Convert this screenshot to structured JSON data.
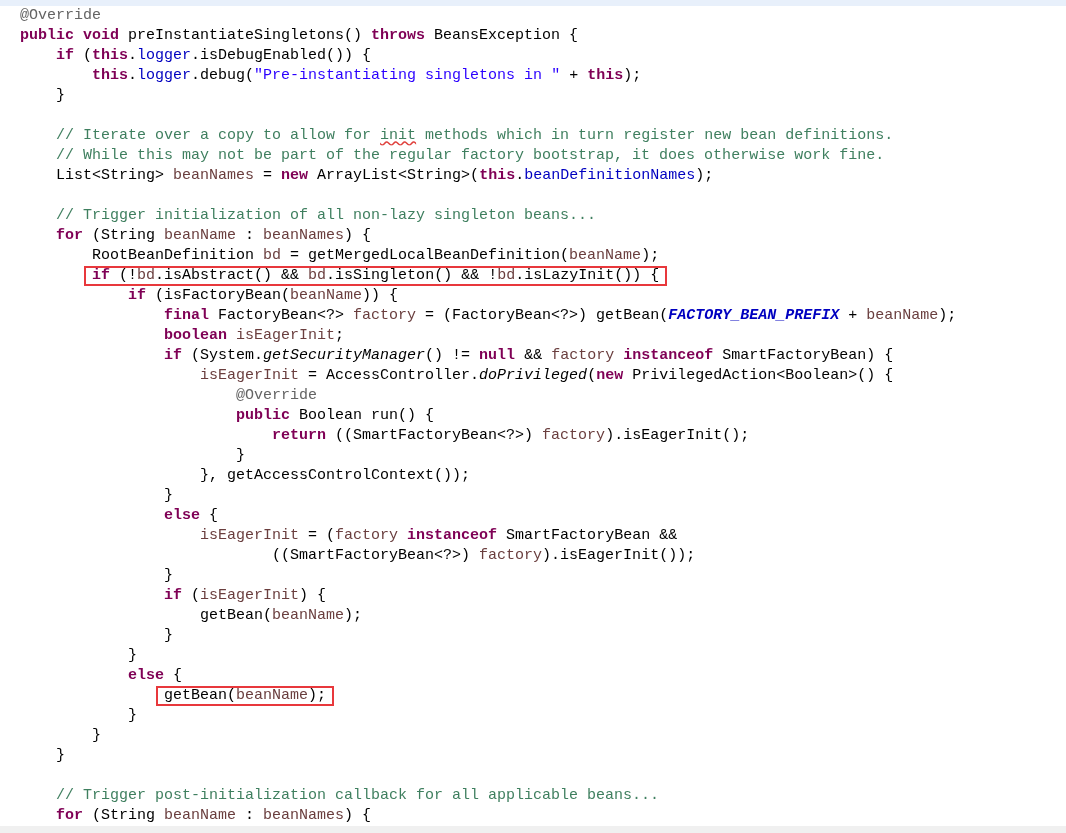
{
  "editor": {
    "lines": [
      {
        "kind": "code",
        "boxed": false,
        "tokens": [
          {
            "kind": "annotation",
            "text": "@Override"
          }
        ]
      },
      {
        "kind": "code",
        "boxed": false,
        "tokens": [
          {
            "kind": "keyword",
            "text": "public void"
          },
          {
            "kind": "plain",
            "text": " preInstantiateSingletons() "
          },
          {
            "kind": "keyword",
            "text": "throws"
          },
          {
            "kind": "plain",
            "text": " BeansException {"
          }
        ]
      },
      {
        "kind": "code",
        "boxed": false,
        "tokens": [
          {
            "kind": "keyword",
            "text": "    if"
          },
          {
            "kind": "plain",
            "text": " ("
          },
          {
            "kind": "keyword",
            "text": "this"
          },
          {
            "kind": "plain",
            "text": "."
          },
          {
            "kind": "field",
            "text": "logger"
          },
          {
            "kind": "plain",
            "text": ".isDebugEnabled()) {"
          }
        ]
      },
      {
        "kind": "code",
        "boxed": false,
        "tokens": [
          {
            "kind": "keyword",
            "text": "        this"
          },
          {
            "kind": "plain",
            "text": "."
          },
          {
            "kind": "field",
            "text": "logger"
          },
          {
            "kind": "plain",
            "text": ".debug("
          },
          {
            "kind": "string",
            "text": "\"Pre-instantiating singletons in \""
          },
          {
            "kind": "plain",
            "text": " + "
          },
          {
            "kind": "keyword",
            "text": "this"
          },
          {
            "kind": "plain",
            "text": ");"
          }
        ]
      },
      {
        "kind": "code",
        "boxed": false,
        "tokens": [
          {
            "kind": "plain",
            "text": "    }"
          }
        ]
      },
      {
        "kind": "blank"
      },
      {
        "kind": "code",
        "boxed": false,
        "tokens": [
          {
            "kind": "comment",
            "text": "    // Iterate over a copy to allow for "
          },
          {
            "kind": "typo",
            "text": "init"
          },
          {
            "kind": "comment",
            "text": " methods which in turn register new bean definitions."
          }
        ]
      },
      {
        "kind": "code",
        "boxed": false,
        "tokens": [
          {
            "kind": "comment",
            "text": "    // While this may not be part of the regular factory bootstrap, it does otherwise work fine."
          }
        ]
      },
      {
        "kind": "code",
        "boxed": false,
        "tokens": [
          {
            "kind": "plain",
            "text": "    List<String> "
          },
          {
            "kind": "local",
            "text": "beanNames"
          },
          {
            "kind": "plain",
            "text": " = "
          },
          {
            "kind": "keyword",
            "text": "new"
          },
          {
            "kind": "plain",
            "text": " ArrayList<String>("
          },
          {
            "kind": "keyword",
            "text": "this"
          },
          {
            "kind": "plain",
            "text": "."
          },
          {
            "kind": "field",
            "text": "beanDefinitionNames"
          },
          {
            "kind": "plain",
            "text": ");"
          }
        ]
      },
      {
        "kind": "blank"
      },
      {
        "kind": "code",
        "boxed": false,
        "tokens": [
          {
            "kind": "comment",
            "text": "    // Trigger initialization of all non-lazy singleton beans..."
          }
        ]
      },
      {
        "kind": "code",
        "boxed": false,
        "tokens": [
          {
            "kind": "keyword",
            "text": "    for"
          },
          {
            "kind": "plain",
            "text": " (String "
          },
          {
            "kind": "local",
            "text": "beanName"
          },
          {
            "kind": "plain",
            "text": " : "
          },
          {
            "kind": "local",
            "text": "beanNames"
          },
          {
            "kind": "plain",
            "text": ") {"
          }
        ]
      },
      {
        "kind": "code",
        "boxed": false,
        "tokens": [
          {
            "kind": "plain",
            "text": "        RootBeanDefinition "
          },
          {
            "kind": "local",
            "text": "bd"
          },
          {
            "kind": "plain",
            "text": " = getMergedLocalBeanDefinition("
          },
          {
            "kind": "local",
            "text": "beanName"
          },
          {
            "kind": "plain",
            "text": ");"
          }
        ]
      },
      {
        "kind": "code",
        "boxed": true,
        "tokens": [
          {
            "kind": "keyword",
            "text": "        if"
          },
          {
            "kind": "plain",
            "text": " (!"
          },
          {
            "kind": "local",
            "text": "bd"
          },
          {
            "kind": "plain",
            "text": ".isAbstract() && "
          },
          {
            "kind": "local",
            "text": "bd"
          },
          {
            "kind": "plain",
            "text": ".isSingleton() && !"
          },
          {
            "kind": "local",
            "text": "bd"
          },
          {
            "kind": "plain",
            "text": ".isLazyInit()) {"
          }
        ]
      },
      {
        "kind": "code",
        "boxed": false,
        "tokens": [
          {
            "kind": "keyword",
            "text": "            if"
          },
          {
            "kind": "plain",
            "text": " (isFactoryBean("
          },
          {
            "kind": "local",
            "text": "beanName"
          },
          {
            "kind": "plain",
            "text": ")) {"
          }
        ]
      },
      {
        "kind": "code",
        "boxed": false,
        "tokens": [
          {
            "kind": "keyword",
            "text": "                final"
          },
          {
            "kind": "plain",
            "text": " FactoryBean<?> "
          },
          {
            "kind": "local",
            "text": "factory"
          },
          {
            "kind": "plain",
            "text": " = (FactoryBean<?>) getBean("
          },
          {
            "kind": "constant",
            "text": "FACTORY_BEAN_PREFIX"
          },
          {
            "kind": "plain",
            "text": " + "
          },
          {
            "kind": "local",
            "text": "beanName"
          },
          {
            "kind": "plain",
            "text": ");"
          }
        ]
      },
      {
        "kind": "code",
        "boxed": false,
        "tokens": [
          {
            "kind": "keyword",
            "text": "                boolean"
          },
          {
            "kind": "local",
            "text": " isEagerInit"
          },
          {
            "kind": "plain",
            "text": ";"
          }
        ]
      },
      {
        "kind": "code",
        "boxed": false,
        "tokens": [
          {
            "kind": "keyword",
            "text": "                if"
          },
          {
            "kind": "plain",
            "text": " (System."
          },
          {
            "kind": "static",
            "text": "getSecurityManager"
          },
          {
            "kind": "plain",
            "text": "() != "
          },
          {
            "kind": "keyword",
            "text": "null"
          },
          {
            "kind": "plain",
            "text": " && "
          },
          {
            "kind": "local",
            "text": "factory "
          },
          {
            "kind": "keyword",
            "text": "instanceof"
          },
          {
            "kind": "plain",
            "text": " SmartFactoryBean) {"
          }
        ]
      },
      {
        "kind": "code",
        "boxed": false,
        "tokens": [
          {
            "kind": "local",
            "text": "                    isEagerInit"
          },
          {
            "kind": "plain",
            "text": " = AccessController."
          },
          {
            "kind": "static",
            "text": "doPrivileged"
          },
          {
            "kind": "plain",
            "text": "("
          },
          {
            "kind": "keyword",
            "text": "new"
          },
          {
            "kind": "plain",
            "text": " PrivilegedAction<Boolean>() {"
          }
        ]
      },
      {
        "kind": "code",
        "boxed": false,
        "tokens": [
          {
            "kind": "annotation",
            "text": "                        @Override"
          }
        ]
      },
      {
        "kind": "code",
        "boxed": false,
        "tokens": [
          {
            "kind": "keyword",
            "text": "                        public"
          },
          {
            "kind": "plain",
            "text": " Boolean run() {"
          }
        ]
      },
      {
        "kind": "code",
        "boxed": false,
        "tokens": [
          {
            "kind": "keyword",
            "text": "                            return"
          },
          {
            "kind": "plain",
            "text": " ((SmartFactoryBean<?>) "
          },
          {
            "kind": "local",
            "text": "factory"
          },
          {
            "kind": "plain",
            "text": ").isEagerInit();"
          }
        ]
      },
      {
        "kind": "code",
        "boxed": false,
        "tokens": [
          {
            "kind": "plain",
            "text": "                        }"
          }
        ]
      },
      {
        "kind": "code",
        "boxed": false,
        "tokens": [
          {
            "kind": "plain",
            "text": "                    }, getAccessControlContext());"
          }
        ]
      },
      {
        "kind": "code",
        "boxed": false,
        "tokens": [
          {
            "kind": "plain",
            "text": "                }"
          }
        ]
      },
      {
        "kind": "code",
        "boxed": false,
        "tokens": [
          {
            "kind": "keyword",
            "text": "                else"
          },
          {
            "kind": "plain",
            "text": " {"
          }
        ]
      },
      {
        "kind": "code",
        "boxed": false,
        "tokens": [
          {
            "kind": "local",
            "text": "                    isEagerInit"
          },
          {
            "kind": "plain",
            "text": " = ("
          },
          {
            "kind": "local",
            "text": "factory "
          },
          {
            "kind": "keyword",
            "text": "instanceof"
          },
          {
            "kind": "plain",
            "text": " SmartFactoryBean &&"
          }
        ]
      },
      {
        "kind": "code",
        "boxed": false,
        "tokens": [
          {
            "kind": "plain",
            "text": "                            ((SmartFactoryBean<?>) "
          },
          {
            "kind": "local",
            "text": "factory"
          },
          {
            "kind": "plain",
            "text": ").isEagerInit());"
          }
        ]
      },
      {
        "kind": "code",
        "boxed": false,
        "tokens": [
          {
            "kind": "plain",
            "text": "                }"
          }
        ]
      },
      {
        "kind": "code",
        "boxed": false,
        "tokens": [
          {
            "kind": "keyword",
            "text": "                if"
          },
          {
            "kind": "plain",
            "text": " ("
          },
          {
            "kind": "local",
            "text": "isEagerInit"
          },
          {
            "kind": "plain",
            "text": ") {"
          }
        ]
      },
      {
        "kind": "code",
        "boxed": false,
        "tokens": [
          {
            "kind": "plain",
            "text": "                    getBean("
          },
          {
            "kind": "local",
            "text": "beanName"
          },
          {
            "kind": "plain",
            "text": ");"
          }
        ]
      },
      {
        "kind": "code",
        "boxed": false,
        "tokens": [
          {
            "kind": "plain",
            "text": "                }"
          }
        ]
      },
      {
        "kind": "code",
        "boxed": false,
        "tokens": [
          {
            "kind": "plain",
            "text": "            }"
          }
        ]
      },
      {
        "kind": "code",
        "boxed": false,
        "tokens": [
          {
            "kind": "keyword",
            "text": "            else"
          },
          {
            "kind": "plain",
            "text": " {"
          }
        ]
      },
      {
        "kind": "code",
        "boxed": true,
        "tokens": [
          {
            "kind": "plain",
            "text": "                getBean("
          },
          {
            "kind": "local",
            "text": "beanName"
          },
          {
            "kind": "plain",
            "text": ");"
          }
        ]
      },
      {
        "kind": "code",
        "boxed": false,
        "tokens": [
          {
            "kind": "plain",
            "text": "            }"
          }
        ]
      },
      {
        "kind": "code",
        "boxed": false,
        "tokens": [
          {
            "kind": "plain",
            "text": "        }"
          }
        ]
      },
      {
        "kind": "code",
        "boxed": false,
        "tokens": [
          {
            "kind": "plain",
            "text": "    }"
          }
        ]
      },
      {
        "kind": "blank"
      },
      {
        "kind": "code",
        "boxed": false,
        "tokens": [
          {
            "kind": "comment",
            "text": "    // Trigger post-initialization callback for all applicable beans..."
          }
        ]
      },
      {
        "kind": "code",
        "boxed": false,
        "tokens": [
          {
            "kind": "keyword",
            "text": "    for"
          },
          {
            "kind": "plain",
            "text": " (String "
          },
          {
            "kind": "local",
            "text": "beanName"
          },
          {
            "kind": "plain",
            "text": " : "
          },
          {
            "kind": "local",
            "text": "beanNames"
          },
          {
            "kind": "plain",
            "text": ") {"
          }
        ]
      }
    ]
  }
}
